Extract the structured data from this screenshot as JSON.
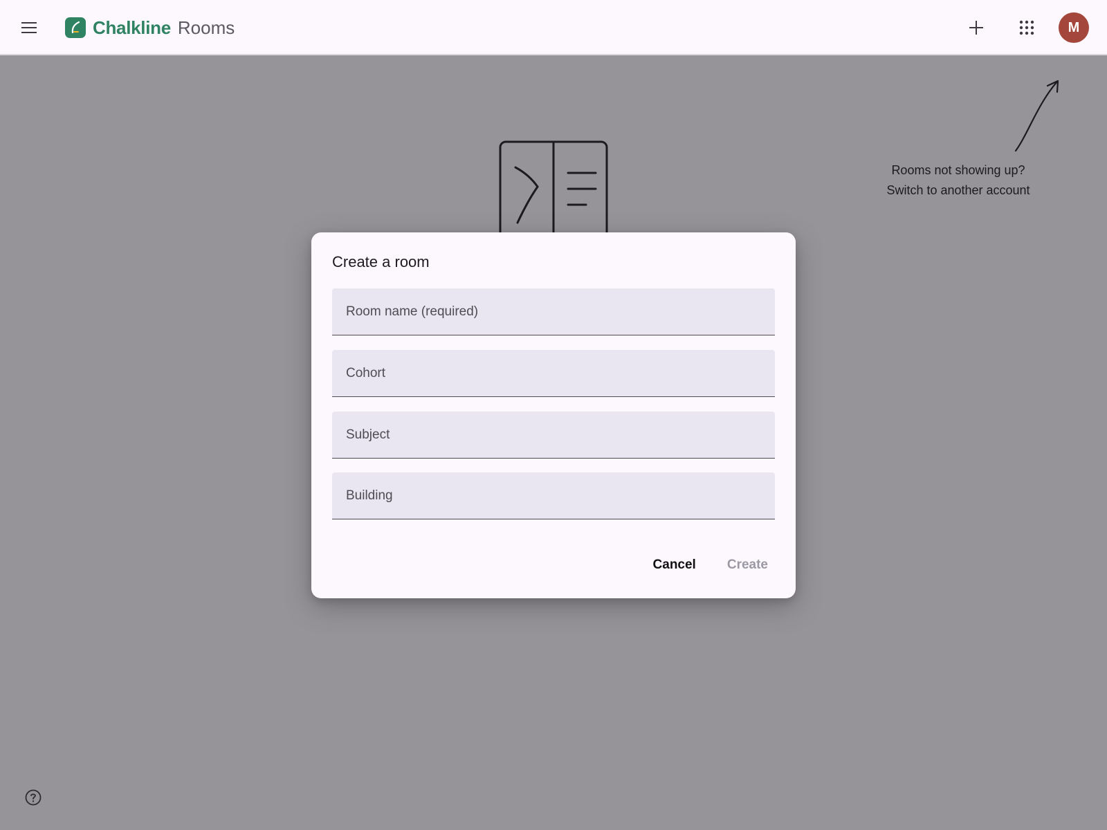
{
  "header": {
    "brand_name": "Chalkline",
    "brand_product": "Rooms",
    "avatar_initial": "M"
  },
  "hint": {
    "line1": "Rooms not showing up?",
    "line2": "Switch to another account"
  },
  "dialog": {
    "title": "Create a room",
    "fields": [
      {
        "placeholder": "Room name (required)",
        "value": ""
      },
      {
        "placeholder": "Cohort",
        "value": ""
      },
      {
        "placeholder": "Subject",
        "value": ""
      },
      {
        "placeholder": "Building",
        "value": ""
      }
    ],
    "cancel_label": "Cancel",
    "create_label": "Create"
  },
  "icons": {
    "menu": "hamburger-menu-icon",
    "add": "plus-icon",
    "apps": "apps-grid-icon",
    "help": "help-circle-icon"
  },
  "colors": {
    "brand": "#2f8363",
    "avatar": "#a4463b",
    "disabled_text": "#9b99a3"
  }
}
